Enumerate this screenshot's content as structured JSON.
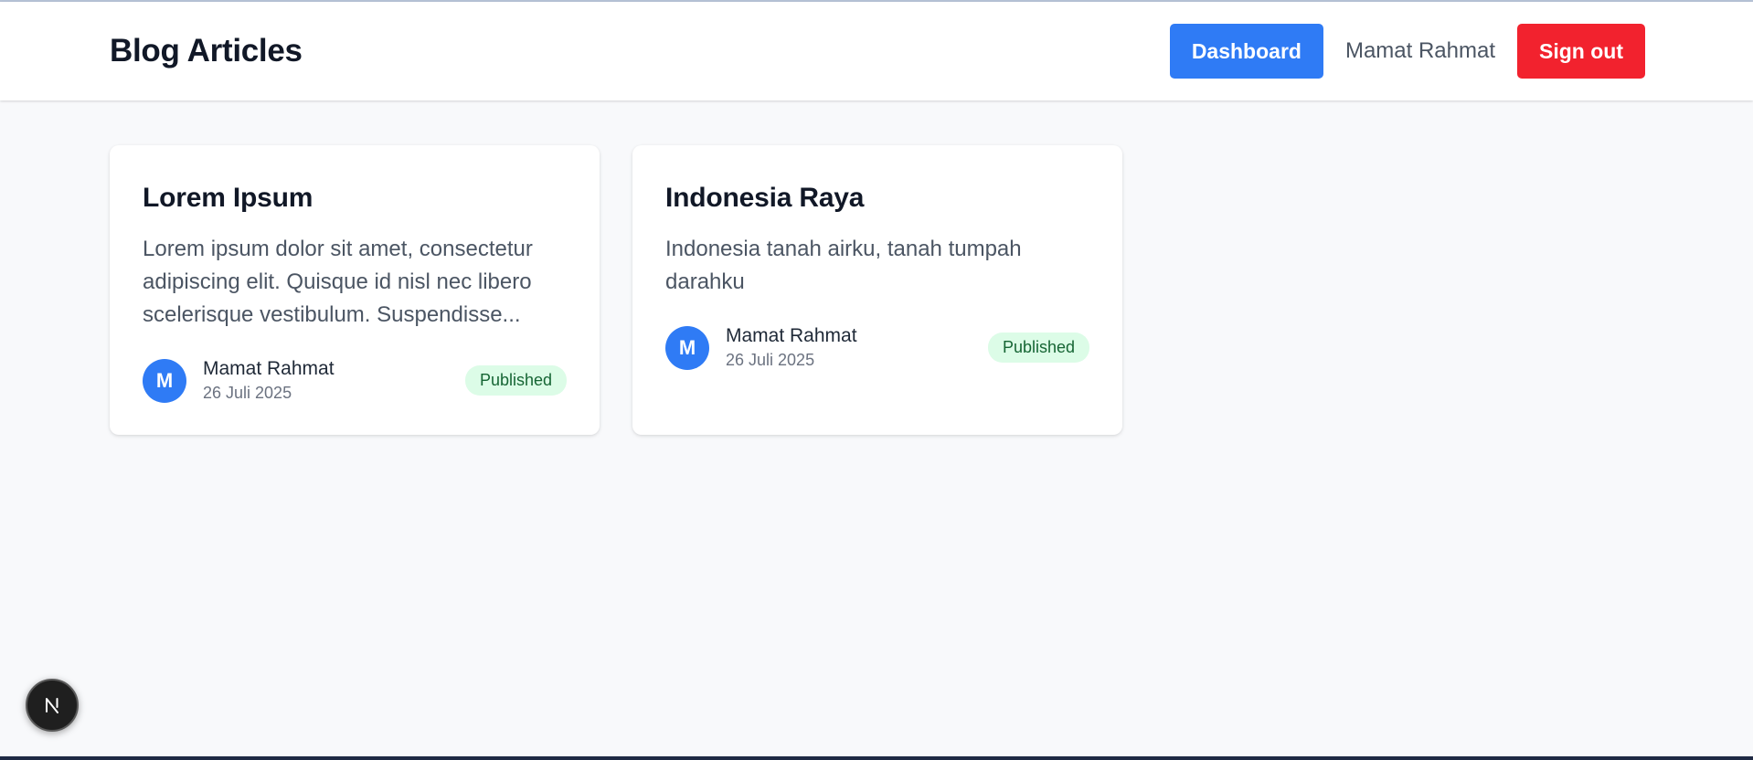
{
  "header": {
    "title": "Blog Articles",
    "dashboard_label": "Dashboard",
    "user_name": "Mamat Rahmat",
    "signout_label": "Sign out"
  },
  "articles": [
    {
      "title": "Lorem Ipsum",
      "excerpt": "Lorem ipsum dolor sit amet, consectetur adipiscing elit. Quisque id nisl nec libero scelerisque vestibulum. Suspendisse...",
      "author_initial": "M",
      "author": "Mamat Rahmat",
      "date": "26 Juli 2025",
      "status": "Published"
    },
    {
      "title": "Indonesia Raya",
      "excerpt": "Indonesia tanah airku, tanah tumpah darahku",
      "author_initial": "M",
      "author": "Mamat Rahmat",
      "date": "26 Juli 2025",
      "status": "Published"
    }
  ],
  "dev_indicator": {
    "icon": "nextjs-logo-icon"
  },
  "colors": {
    "primary": "#2f7bf5",
    "danger": "#f2222e",
    "badge_bg": "#dcfce7",
    "badge_text": "#166534"
  }
}
